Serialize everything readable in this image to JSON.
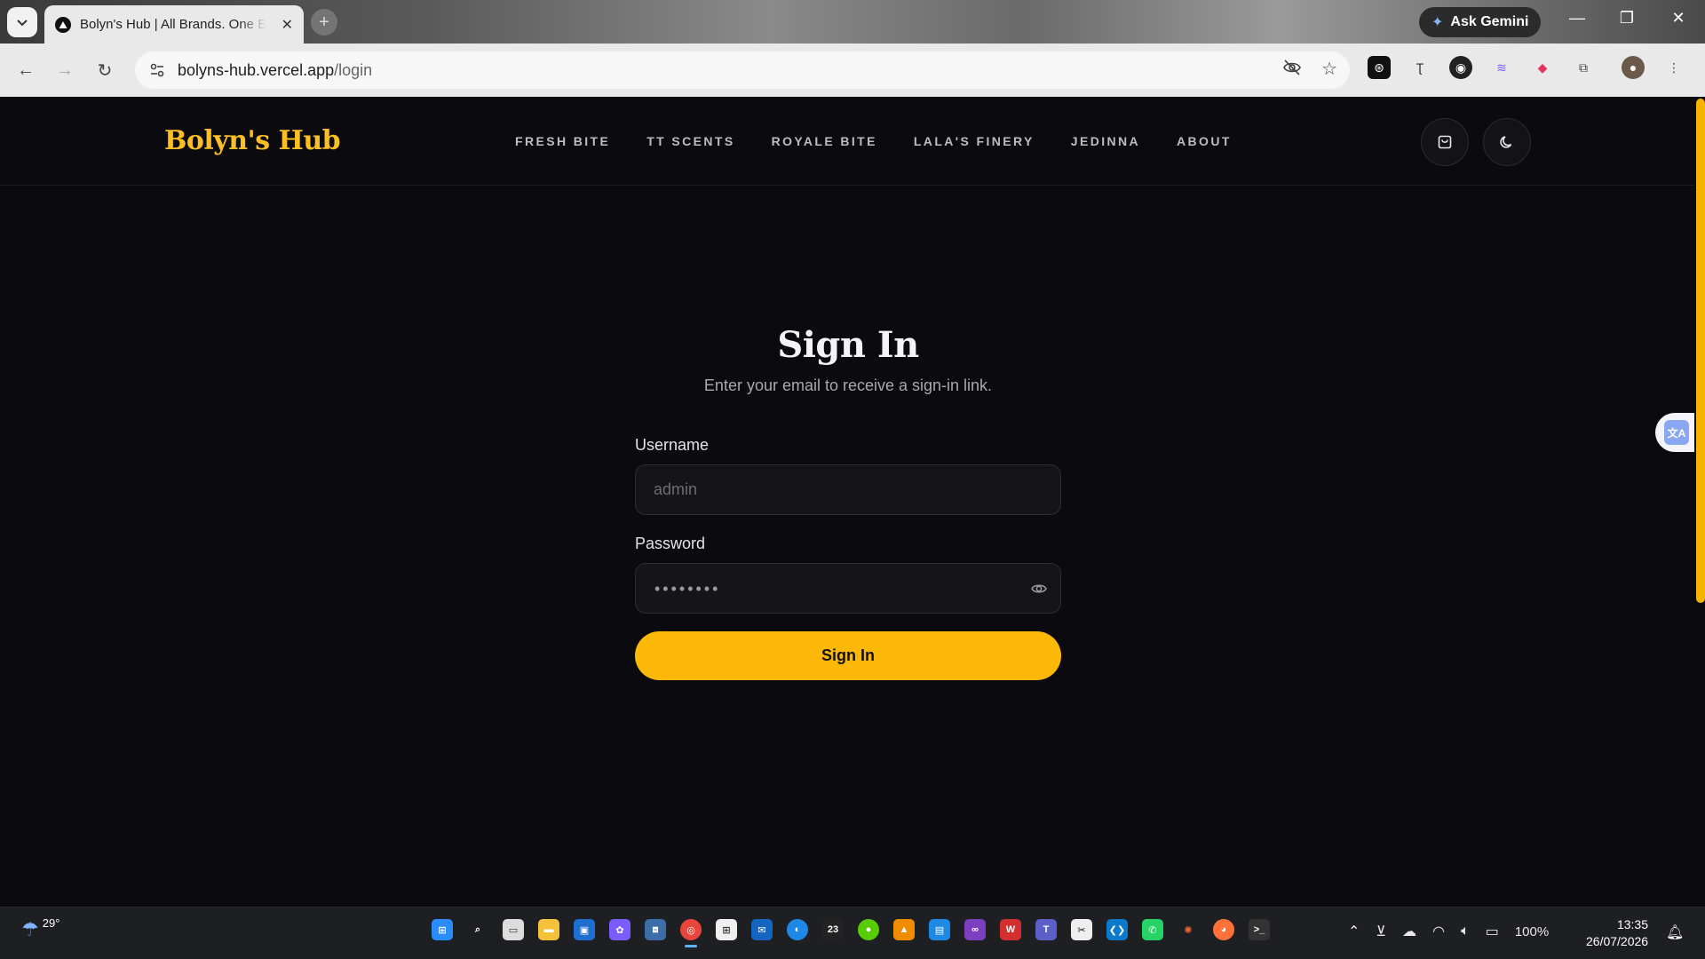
{
  "browser": {
    "tab_title": "Bolyn's Hub | All Brands. One Experience",
    "new_tab": "+",
    "ask_gemini": "Ask Gemini",
    "url_host": "bolyns-hub.vercel.app",
    "url_path": "/login"
  },
  "site": {
    "brand": "Bolyn's Hub",
    "nav": [
      "FRESH BITE",
      "TT SCENTS",
      "ROYALE BITE",
      "LALA'S FINERY",
      "JEDINNA",
      "ABOUT"
    ],
    "accent": "#fbb806"
  },
  "login": {
    "title": "Sign In",
    "subtitle": "Enter your email to receive a sign-in link.",
    "username_label": "Username",
    "username_placeholder": "admin",
    "password_label": "Password",
    "password_mask": "••••••••",
    "submit": "Sign In"
  },
  "taskbar": {
    "temperature": "29°",
    "battery": "100%",
    "time": "13:35",
    "date": "26/07/2026",
    "app_badge": "23"
  },
  "icons": {
    "tab_search": "chevron-down-icon",
    "cart": "shopping-bag-icon",
    "theme": "moon-icon",
    "password_toggle": "eye-icon",
    "translate": "translate-icon"
  }
}
